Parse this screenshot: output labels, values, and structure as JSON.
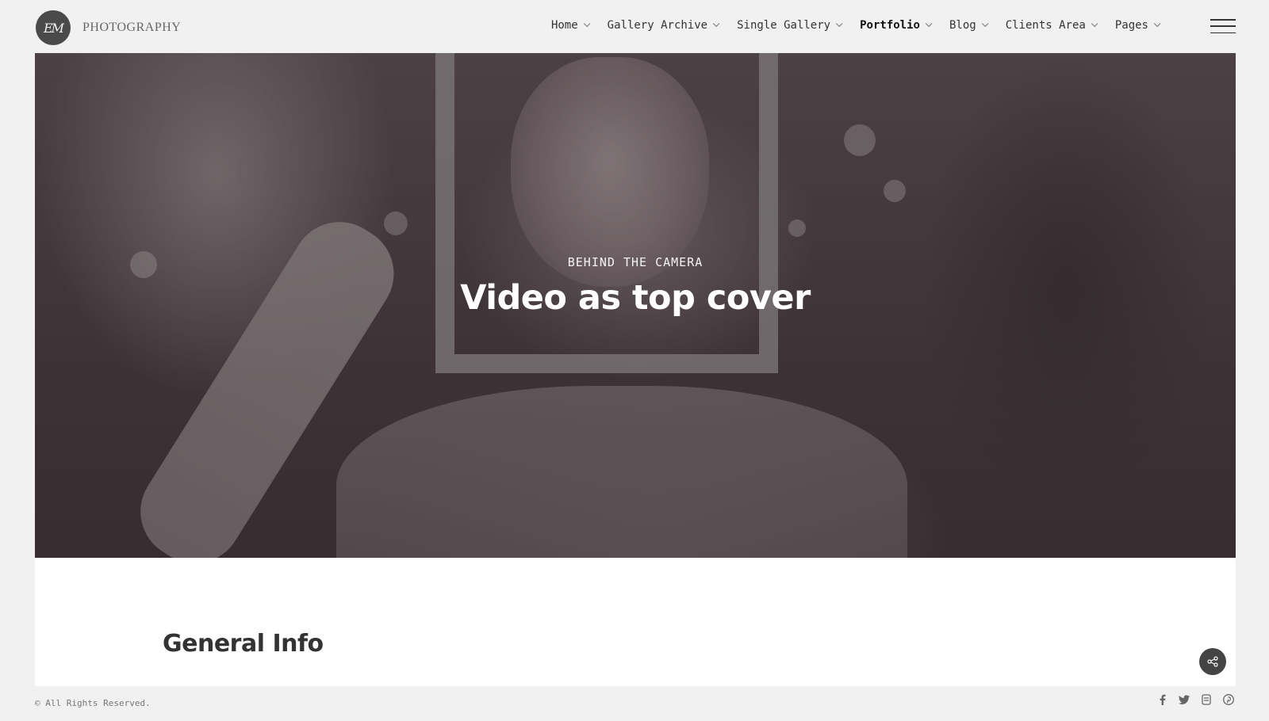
{
  "brand": {
    "logo_initials": "EM",
    "name": "PHOTOGRAPHY"
  },
  "nav": {
    "items": [
      {
        "label": "Home",
        "active": false
      },
      {
        "label": "Gallery Archive",
        "active": false
      },
      {
        "label": "Single Gallery",
        "active": false
      },
      {
        "label": "Portfolio",
        "active": true
      },
      {
        "label": "Blog",
        "active": false
      },
      {
        "label": "Clients Area",
        "active": false
      },
      {
        "label": "Pages",
        "active": false
      }
    ],
    "menu_icon": "hamburger-icon"
  },
  "hero": {
    "subtitle": "BEHIND THE CAMERA",
    "title": "Video as top cover"
  },
  "content": {
    "section_title": "General Info",
    "share_icon": "share-icon"
  },
  "footer": {
    "copyright": "© All Rights Reserved.",
    "social_icons": [
      "facebook-icon",
      "twitter-icon",
      "500px-icon",
      "pinterest-icon"
    ]
  },
  "colors": {
    "page_bg": "#f1f1f1",
    "panel_bg": "#ffffff",
    "text_dark": "#333333",
    "share_button": "#444444"
  }
}
